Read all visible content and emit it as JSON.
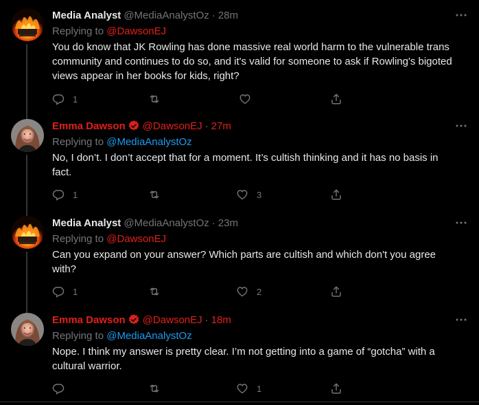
{
  "tweets": [
    {
      "name": "Media Analyst",
      "handle": "@MediaAnalystOz",
      "dot": "·",
      "time": "28m",
      "replying_label": "Replying to",
      "replying_to": "@DawsonEJ",
      "text": "You do know that JK Rowling has done massive real world harm to the vulnerable trans community and continues to do so, and it's valid for someone to ask if Rowling's bigoted views appear in her books for kids, right?",
      "reply_count": "1",
      "retweet_count": "",
      "like_count": ""
    },
    {
      "name": "Emma Dawson",
      "handle": "@DawsonEJ",
      "dot": "·",
      "time": "27m",
      "replying_label": "Replying to",
      "replying_to": "@MediaAnalystOz",
      "text": "No, I don’t. I don’t accept that for a moment. It’s cultish thinking and it has no basis in fact.",
      "reply_count": "1",
      "retweet_count": "",
      "like_count": "3"
    },
    {
      "name": "Media Analyst",
      "handle": "@MediaAnalystOz",
      "dot": "·",
      "time": "23m",
      "replying_label": "Replying to",
      "replying_to": "@DawsonEJ",
      "text": "Can you expand on your answer? Which parts are cultish and which don't you agree with?",
      "reply_count": "1",
      "retweet_count": "",
      "like_count": "2"
    },
    {
      "name": "Emma Dawson",
      "handle": "@DawsonEJ",
      "dot": "·",
      "time": "18m",
      "replying_label": "Replying to",
      "replying_to": "@MediaAnalystOz",
      "text": "Nope. I think my answer is pretty clear. I’m not getting into a game of “gotcha” with a cultural warrior.",
      "reply_count": "",
      "retweet_count": "",
      "like_count": "1"
    }
  ],
  "colors": {
    "background": "#000000",
    "text": "#e7e9ea",
    "muted": "#71767b",
    "link_blue": "#1d9bf0",
    "emma_red": "#e0201c"
  },
  "icons": {
    "more": "more-dots-icon",
    "reply": "reply-bubble-icon",
    "retweet": "retweet-icon",
    "like": "heart-icon",
    "share": "share-upload-icon",
    "verified": "verified-badge-icon",
    "avatar_media": "fire-avatar-image",
    "avatar_emma": "woman-portrait-avatar-image"
  }
}
